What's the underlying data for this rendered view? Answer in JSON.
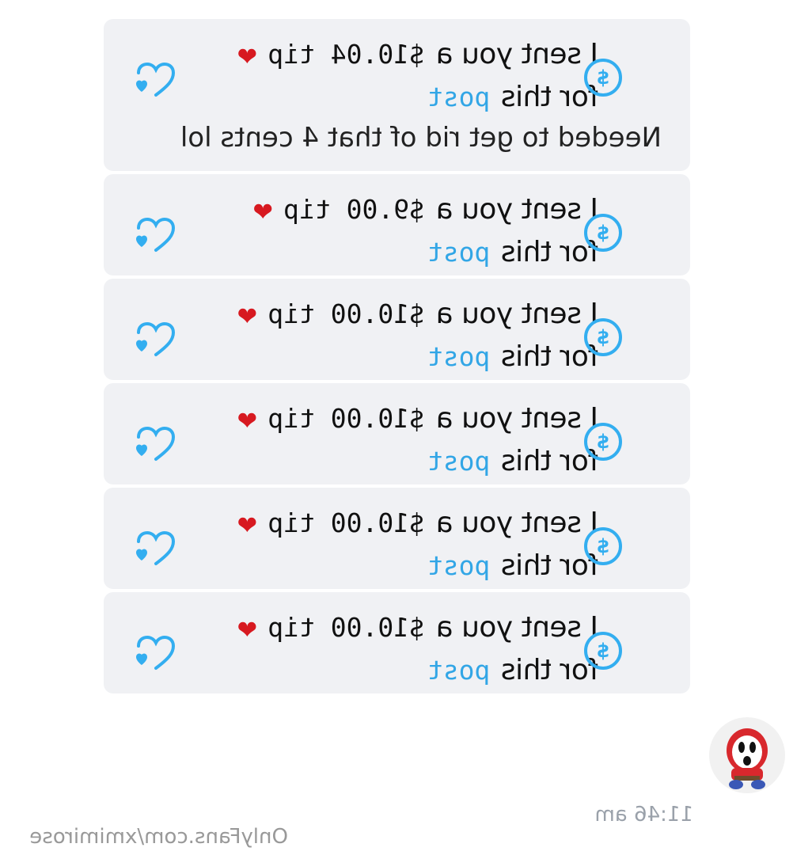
{
  "messages": [
    {
      "line1_prefix": "I sent you a",
      "amount_text": "$10.04 tip",
      "line2_prefix": "for this",
      "link": "post",
      "text": "Needed to get rid of that 4 cents lol"
    },
    {
      "line1_prefix": "I sent you a",
      "amount_text": "$9.00 tip",
      "line2_prefix": "for this",
      "link": "post"
    },
    {
      "line1_prefix": "I sent you a",
      "amount_text": "$10.00 tip",
      "line2_prefix": "for this",
      "link": "post"
    },
    {
      "line1_prefix": "I sent you a",
      "amount_text": "$10.00 tip",
      "line2_prefix": "for this",
      "link": "post"
    },
    {
      "line1_prefix": "I sent you a",
      "amount_text": "$10.00 tip",
      "line2_prefix": "for this",
      "link": "post"
    },
    {
      "line1_prefix": "I sent you a",
      "amount_text": "$10.00 tip",
      "line2_prefix": "for this",
      "link": "post"
    }
  ],
  "icons": {
    "heart_emoji": "❤",
    "dollar_symbol": "$",
    "like": "heart-like-icon",
    "dollar": "dollar-circle-icon"
  },
  "timestamp": "11:46 am",
  "watermark": "OnlyFans.com/xmimirose",
  "colors": {
    "accent": "#33aef0",
    "bubble": "#f0f1f4",
    "heart": "#d71920"
  }
}
